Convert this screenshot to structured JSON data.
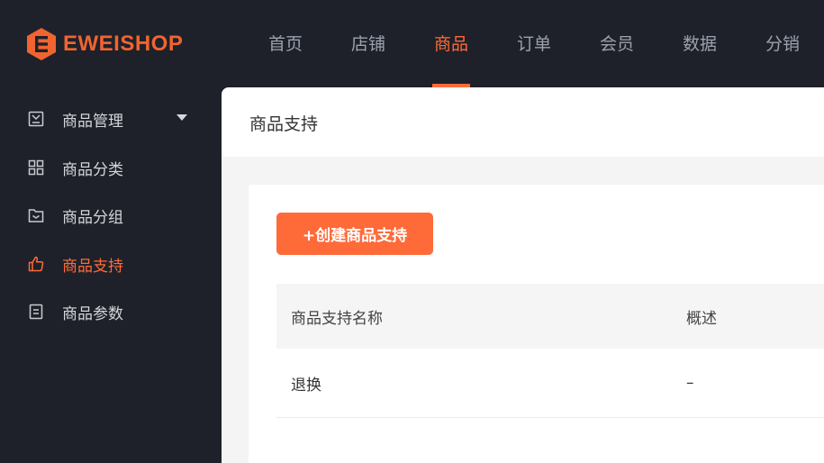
{
  "brand": {
    "name": "EWEISHOP",
    "color": "#f06431"
  },
  "top_nav": {
    "items": [
      {
        "label": "首页"
      },
      {
        "label": "店铺"
      },
      {
        "label": "商品"
      },
      {
        "label": "订单"
      },
      {
        "label": "会员"
      },
      {
        "label": "数据"
      },
      {
        "label": "分销"
      }
    ],
    "active": "商品"
  },
  "sidebar": {
    "items": [
      {
        "label": "商品管理",
        "icon": "product-manage-icon",
        "has_caret": true
      },
      {
        "label": "商品分类",
        "icon": "grid-icon"
      },
      {
        "label": "商品分组",
        "icon": "folder-icon"
      },
      {
        "label": "商品支持",
        "icon": "thumbs-up-icon",
        "active": true
      },
      {
        "label": "商品参数",
        "icon": "document-icon"
      }
    ]
  },
  "main": {
    "title": "商品支持",
    "create_button": "+创建商品支持",
    "table": {
      "headers": [
        "商品支持名称",
        "概述"
      ],
      "rows": [
        [
          "退换",
          "–"
        ]
      ]
    }
  },
  "colors": {
    "accent": "#ff6a39",
    "background": "#1e2129",
    "panel": "#f4f4f4"
  }
}
